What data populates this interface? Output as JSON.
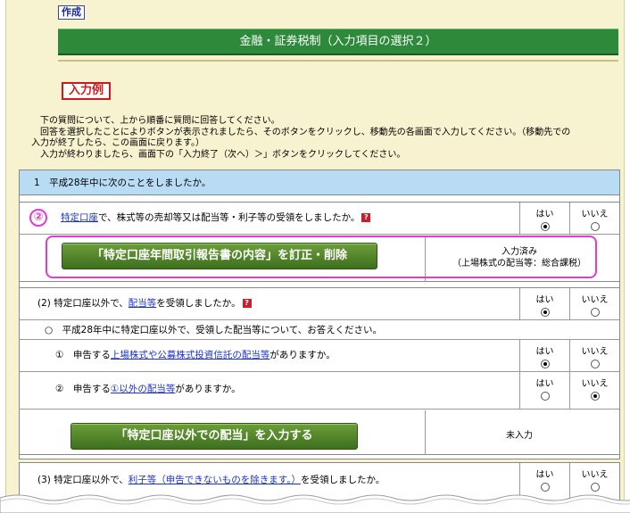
{
  "header": {
    "create_tag": "作成",
    "title": "金融・証券税制（入力項目の選択２）",
    "example_button": "入力例"
  },
  "instructions": [
    "下の質問について、上から順番に質問に回答してください。",
    "回答を選択したことによりボタンが表示されましたら、そのボタンをクリックし、移動先の各画面で入力してください。（移動先での",
    "入力が終了したら、この画面に戻ります。）",
    "入力が終わりましたら、画面下の「入力終了（次へ）＞」ボタンをクリックしてください。"
  ],
  "section1": {
    "heading": "1　平成28年中に次のことをしましたか。",
    "badge": "②",
    "q1": {
      "link": "特定口座",
      "text": "で、株式等の売却等又は配当等・利子等の受領をしましたか。",
      "yes": "はい",
      "no": "いいえ",
      "selected": "yes"
    },
    "q1_button": "「特定口座年間取引報告書の内容」を訂正・削除",
    "q1_status_line1": "入力済み",
    "q1_status_line2": "（上場株式の配当等：総合課税）",
    "q2": {
      "prefix": "(2) 特定口座以外で、",
      "link": "配当等",
      "text": "を受領しましたか。",
      "yes": "はい",
      "no": "いいえ",
      "selected": "yes"
    },
    "sub_heading": "○　平成28年中に特定口座以外で、受領した配当等について、お答えください。",
    "sub1": {
      "prefix": "①　申告する",
      "link": "上場株式や公募株式投資信託の配当等",
      "text": "がありますか。",
      "yes": "はい",
      "no": "いいえ",
      "selected": "yes"
    },
    "sub2": {
      "prefix": "②　申告する",
      "link": "①以外の配当等",
      "text": "がありますか。",
      "yes": "はい",
      "no": "いいえ",
      "selected": "no"
    },
    "q2_button": "「特定口座以外での配当」を入力する",
    "q2_status": "未入力",
    "q3": {
      "prefix": "(3) 特定口座以外で、",
      "link": "利子等（申告できないものを除きます。）",
      "text": "を受領しましたか。",
      "yes": "はい",
      "no": "いいえ"
    }
  },
  "colors": {
    "title_green": "#2d8a3a",
    "button_green": "#4f8228",
    "highlight_pink": "#e23ccf",
    "section_blue": "#b9dcf5",
    "example_red": "#d21818"
  }
}
